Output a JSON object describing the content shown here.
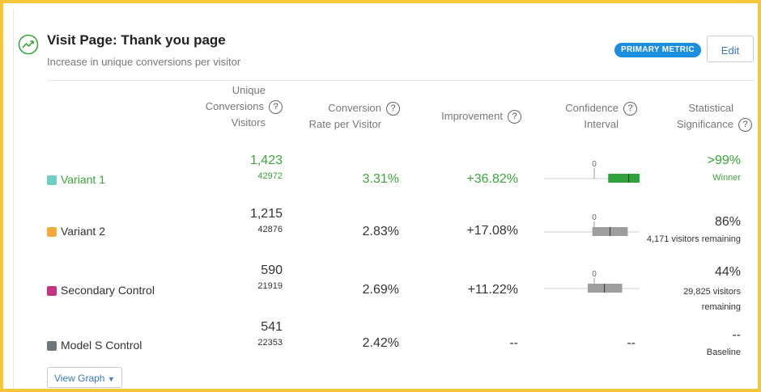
{
  "header": {
    "title": "Visit Page: Thank you page",
    "subtitle": "Increase in unique conversions per visitor",
    "badge": "PRIMARY METRIC",
    "edit_label": "Edit"
  },
  "columns": {
    "unique_line1": "Unique",
    "unique_line2": "Conversions",
    "unique_line3": "Visitors",
    "rate_line1": "Conversion",
    "rate_line2": "Rate per Visitor",
    "improvement": "Improvement",
    "ci_line1": "Confidence",
    "ci_line2": "Interval",
    "sig_line1": "Statistical",
    "sig_line2": "Significance",
    "help_glyph": "?"
  },
  "rows": [
    {
      "name": "Variant 1",
      "color": "#6fcdc4",
      "name_color": "#3aa53a",
      "conversions": "1,423",
      "visitors": "42972",
      "rate": "3.31%",
      "improvement": "+36.82%",
      "sig": ">99%",
      "sig_note": "Winner",
      "zero_label": "0",
      "ci": {
        "low": 0.15,
        "high": 0.57,
        "point": 0.37
      },
      "ci_color": "#2ea13a"
    },
    {
      "name": "Variant 2",
      "color": "#f2aa3c",
      "name_color": "#333333",
      "conversions": "1,215",
      "visitors": "42876",
      "rate": "2.83%",
      "improvement": "+17.08%",
      "sig": "86%",
      "sig_note": "4,171 visitors remaining",
      "zero_label": "0",
      "ci": {
        "low": -0.02,
        "high": 0.36,
        "point": 0.17
      },
      "ci_color": "#9e9e9e"
    },
    {
      "name": "Secondary Control",
      "color": "#c2357e",
      "name_color": "#333333",
      "conversions": "590",
      "visitors": "21919",
      "rate": "2.69%",
      "improvement": "+11.22%",
      "sig": "44%",
      "sig_note_1": "29,825 visitors",
      "sig_note_2": "remaining",
      "zero_label": "0",
      "ci": {
        "low": -0.07,
        "high": 0.3,
        "point": 0.11
      },
      "ci_color": "#9e9e9e"
    },
    {
      "name": "Model S Control",
      "color": "#6d7780",
      "name_color": "#333333",
      "conversions": "541",
      "visitors": "22353",
      "rate": "2.42%",
      "improvement": "--",
      "ci_text": "--",
      "sig": "--",
      "sig_note": "Baseline"
    }
  ],
  "footer": {
    "view_graph": "View Graph"
  }
}
